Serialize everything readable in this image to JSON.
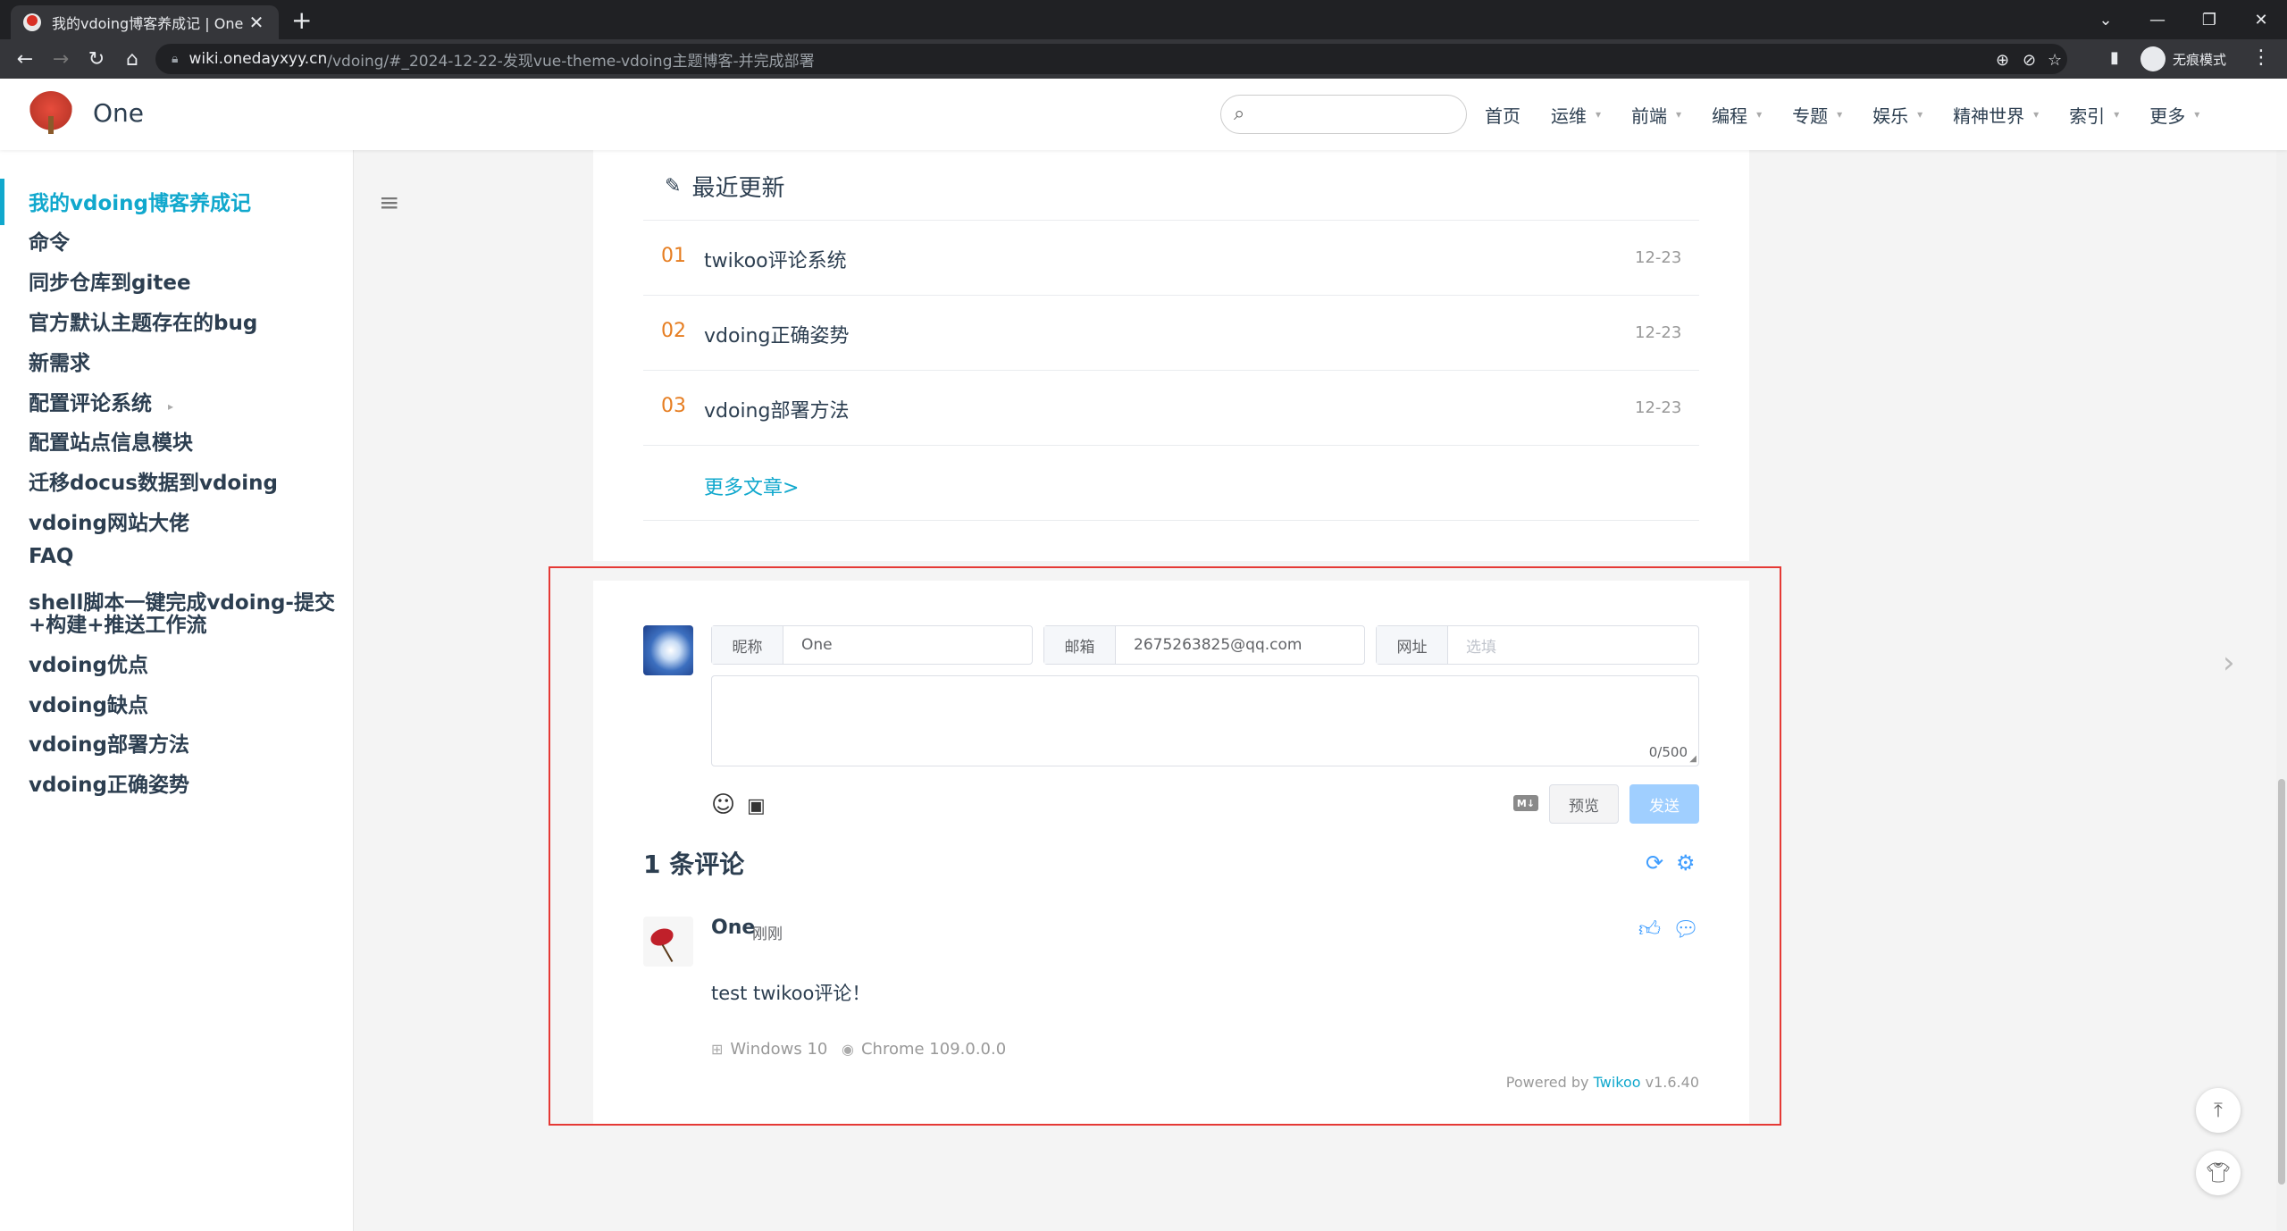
{
  "browser": {
    "tab_title": "我的vdoing博客养成记 | One",
    "tab_close": "✕",
    "new_tab": "+",
    "url_host": "wiki.onedayxyy.cn",
    "url_path": "/vdoing/#_2024-12-22-发现vue-theme-vdoing主题博客-并完成部署",
    "incognito_label": "无痕模式"
  },
  "site": {
    "name": "One",
    "nav": [
      {
        "label": "首页",
        "has_menu": false
      },
      {
        "label": "运维",
        "has_menu": true
      },
      {
        "label": "前端",
        "has_menu": true
      },
      {
        "label": "编程",
        "has_menu": true
      },
      {
        "label": "专题",
        "has_menu": true
      },
      {
        "label": "娱乐",
        "has_menu": true
      },
      {
        "label": "精神世界",
        "has_menu": true
      },
      {
        "label": "索引",
        "has_menu": true
      },
      {
        "label": "更多",
        "has_menu": true
      }
    ]
  },
  "sidebar": {
    "items": [
      {
        "label": "我的vdoing博客养成记",
        "active": true
      },
      {
        "label": "命令"
      },
      {
        "label": "同步仓库到gitee"
      },
      {
        "label": "官方默认主题存在的bug"
      },
      {
        "label": "新需求"
      },
      {
        "label": "配置评论系统",
        "has_children": true
      },
      {
        "label": "配置站点信息模块"
      },
      {
        "label": "迁移docus数据到vdoing"
      },
      {
        "label": "vdoing网站大佬"
      },
      {
        "label": "FAQ"
      },
      {
        "label": "shell脚本一键完成vdoing-提交"
      },
      {
        "label": "+构建+推送工作流"
      },
      {
        "label": "vdoing优点"
      },
      {
        "label": "vdoing缺点"
      },
      {
        "label": "vdoing部署方法"
      },
      {
        "label": "vdoing正确姿势"
      }
    ]
  },
  "recent": {
    "title": "最近更新",
    "items": [
      {
        "num": "01",
        "title": "twikoo评论系统",
        "date": "12-23"
      },
      {
        "num": "02",
        "title": "vdoing正确姿势",
        "date": "12-23"
      },
      {
        "num": "03",
        "title": "vdoing部署方法",
        "date": "12-23"
      }
    ],
    "more": "更多文章>"
  },
  "comment_form": {
    "nick_label": "昵称",
    "nick_value": "One",
    "mail_label": "邮箱",
    "mail_value": "2675263825@qq.com",
    "link_label": "网址",
    "link_placeholder": "选填",
    "counter": "0/500",
    "md_badge": "M↓",
    "preview": "预览",
    "send": "发送"
  },
  "comments": {
    "count_title": "1 条评论",
    "items": [
      {
        "nick": "One",
        "time": "刚刚",
        "content": "test twikoo评论！",
        "os": "Windows 10",
        "browser": "Chrome 109.0.0.0"
      }
    ],
    "powered_prefix": "Powered by ",
    "powered_name": "Twikoo",
    "powered_version": " v1.6.40"
  },
  "colors": {
    "accent": "#11a8cd",
    "rank_number": "#e67e22",
    "highlight_border": "#e53935",
    "send_button": "#a0cfff",
    "icon_blue": "#409eff"
  },
  "icons": {
    "search": "search-icon",
    "menu": "hamburger-icon",
    "pencil": "pencil-icon",
    "emoji": "smile-icon",
    "image": "image-icon",
    "refresh": "refresh-icon",
    "settings": "gear-icon",
    "like": "thumbs-up-icon",
    "reply": "chat-bubble-icon",
    "back_to_top": "arrow-up-icon",
    "theme": "shirt-icon",
    "next": "chevron-right-icon"
  }
}
